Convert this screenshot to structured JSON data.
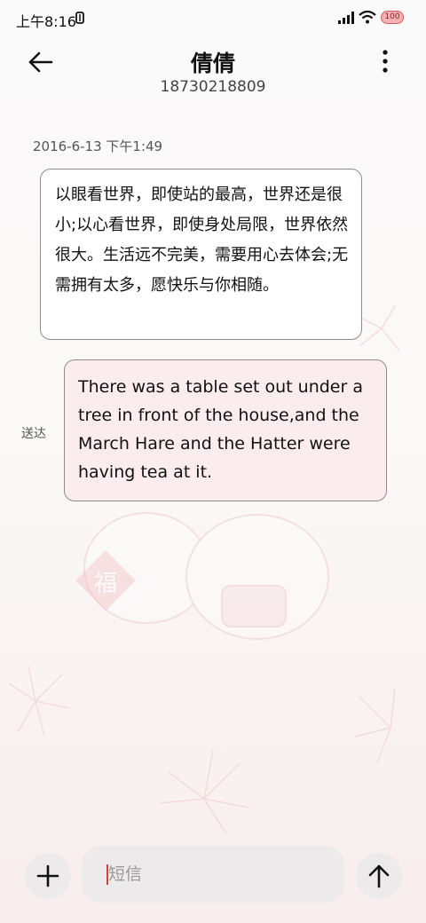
{
  "status_bar": {
    "time": "上午8:16",
    "battery": "100"
  },
  "header": {
    "contact_name": "倩倩",
    "phone_number": "18730218809"
  },
  "conversation": {
    "timestamp": "2016-6-13 下午1:49",
    "messages": [
      {
        "direction": "incoming",
        "text": "以眼看世界，即使站的最高，世界还是很小;以心看世界，即使身处局限，世界依然很大。生活远不完美，需要用心去体会;无需拥有太多，愿快乐与你相随。"
      },
      {
        "direction": "outgoing",
        "text": "There was a table set out under a tree in front of the house,and the March Hare and the Hatter were having tea at it.",
        "status": "送达"
      }
    ]
  },
  "composer": {
    "placeholder": "短信"
  },
  "icons": {
    "back": "arrow-left-icon",
    "more": "more-vertical-icon",
    "add": "plus-icon",
    "send": "arrow-up-icon"
  },
  "colors": {
    "outgoing_bubble": "#fbecee",
    "incoming_bubble": "#ffffff",
    "caret": "#e0393e",
    "battery": "#f4b2b4"
  }
}
